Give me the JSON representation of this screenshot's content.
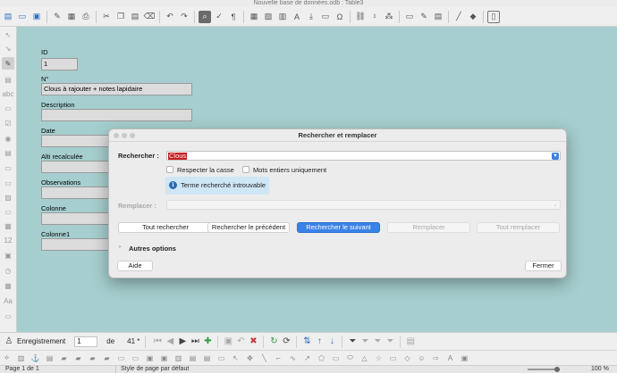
{
  "window": {
    "title": "Nouvelle base de données.odb : Table3"
  },
  "form": {
    "fields": [
      {
        "label": "ID",
        "value": "1"
      },
      {
        "label": "N°",
        "value": "Clous à rajouter + notes lapidaire"
      },
      {
        "label": "Description",
        "value": ""
      },
      {
        "label": "Date",
        "value": ""
      },
      {
        "label": "Alti recalculée",
        "value": ""
      },
      {
        "label": "Observations",
        "value": ""
      },
      {
        "label": "Colonne",
        "value": ""
      },
      {
        "label": "Colonne1",
        "value": ""
      }
    ]
  },
  "sidebar": {
    "labels": {
      "abc": "abc",
      "num": "12",
      "aa": "Aa"
    }
  },
  "dialog": {
    "title": "Rechercher et remplacer",
    "search_label": "Rechercher :",
    "search_value": "Clous",
    "match_case": "Respecter la casse",
    "whole_words": "Mots entiers uniquement",
    "not_found": "Terme recherché introuvable",
    "replace_label": "Remplacer :",
    "buttons": {
      "find_all": "Tout rechercher",
      "find_prev": "Rechercher le précédent",
      "find_next": "Rechercher le suivant",
      "replace": "Remplacer",
      "replace_all": "Tout remplacer"
    },
    "other_options": "Autres options",
    "help": "Aide",
    "close": "Fermer"
  },
  "navigation": {
    "record_label": "Enregistrement",
    "record_value": "1",
    "of_label": "de",
    "total": "41 *"
  },
  "statusbar": {
    "page": "Page 1 de 1",
    "page_style": "Style de page par défaut",
    "zoom": "100 %"
  },
  "colors": {
    "canvas": "#a6cece",
    "accent": "#3a82e8",
    "highlight": "#c21f1f",
    "info": "#cfe6f5"
  }
}
